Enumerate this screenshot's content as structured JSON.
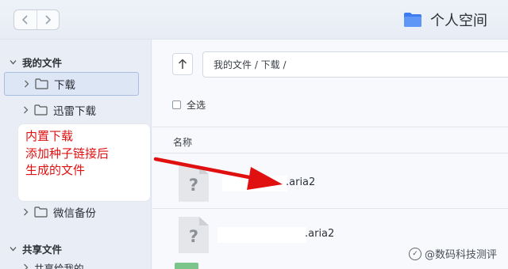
{
  "header": {
    "back_icon": "chevron-left-icon",
    "forward_icon": "chevron-right-icon",
    "title": "个人空间",
    "title_icon": "folder-icon",
    "accent": "#3b7cf2"
  },
  "sidebar": {
    "my_files": "我的文件",
    "items": [
      {
        "label": "下载"
      },
      {
        "label": "迅雷下载"
      },
      {
        "label": "微信备份"
      }
    ],
    "shared_files": "共享文件",
    "partial_item": "共享给我的"
  },
  "callout": {
    "lines": [
      "内置下载",
      "添加种子链接后",
      "生成的文件"
    ],
    "color": "#e11010"
  },
  "main": {
    "path": "我的文件 / 下载 /",
    "select_all": "全选",
    "column_name": "名称",
    "files": [
      {
        "name": ".aria2",
        "icon": "unknown-file-icon"
      },
      {
        "name": ".aria2",
        "icon": "unknown-file-icon"
      }
    ]
  },
  "watermark": "@数码科技测评"
}
